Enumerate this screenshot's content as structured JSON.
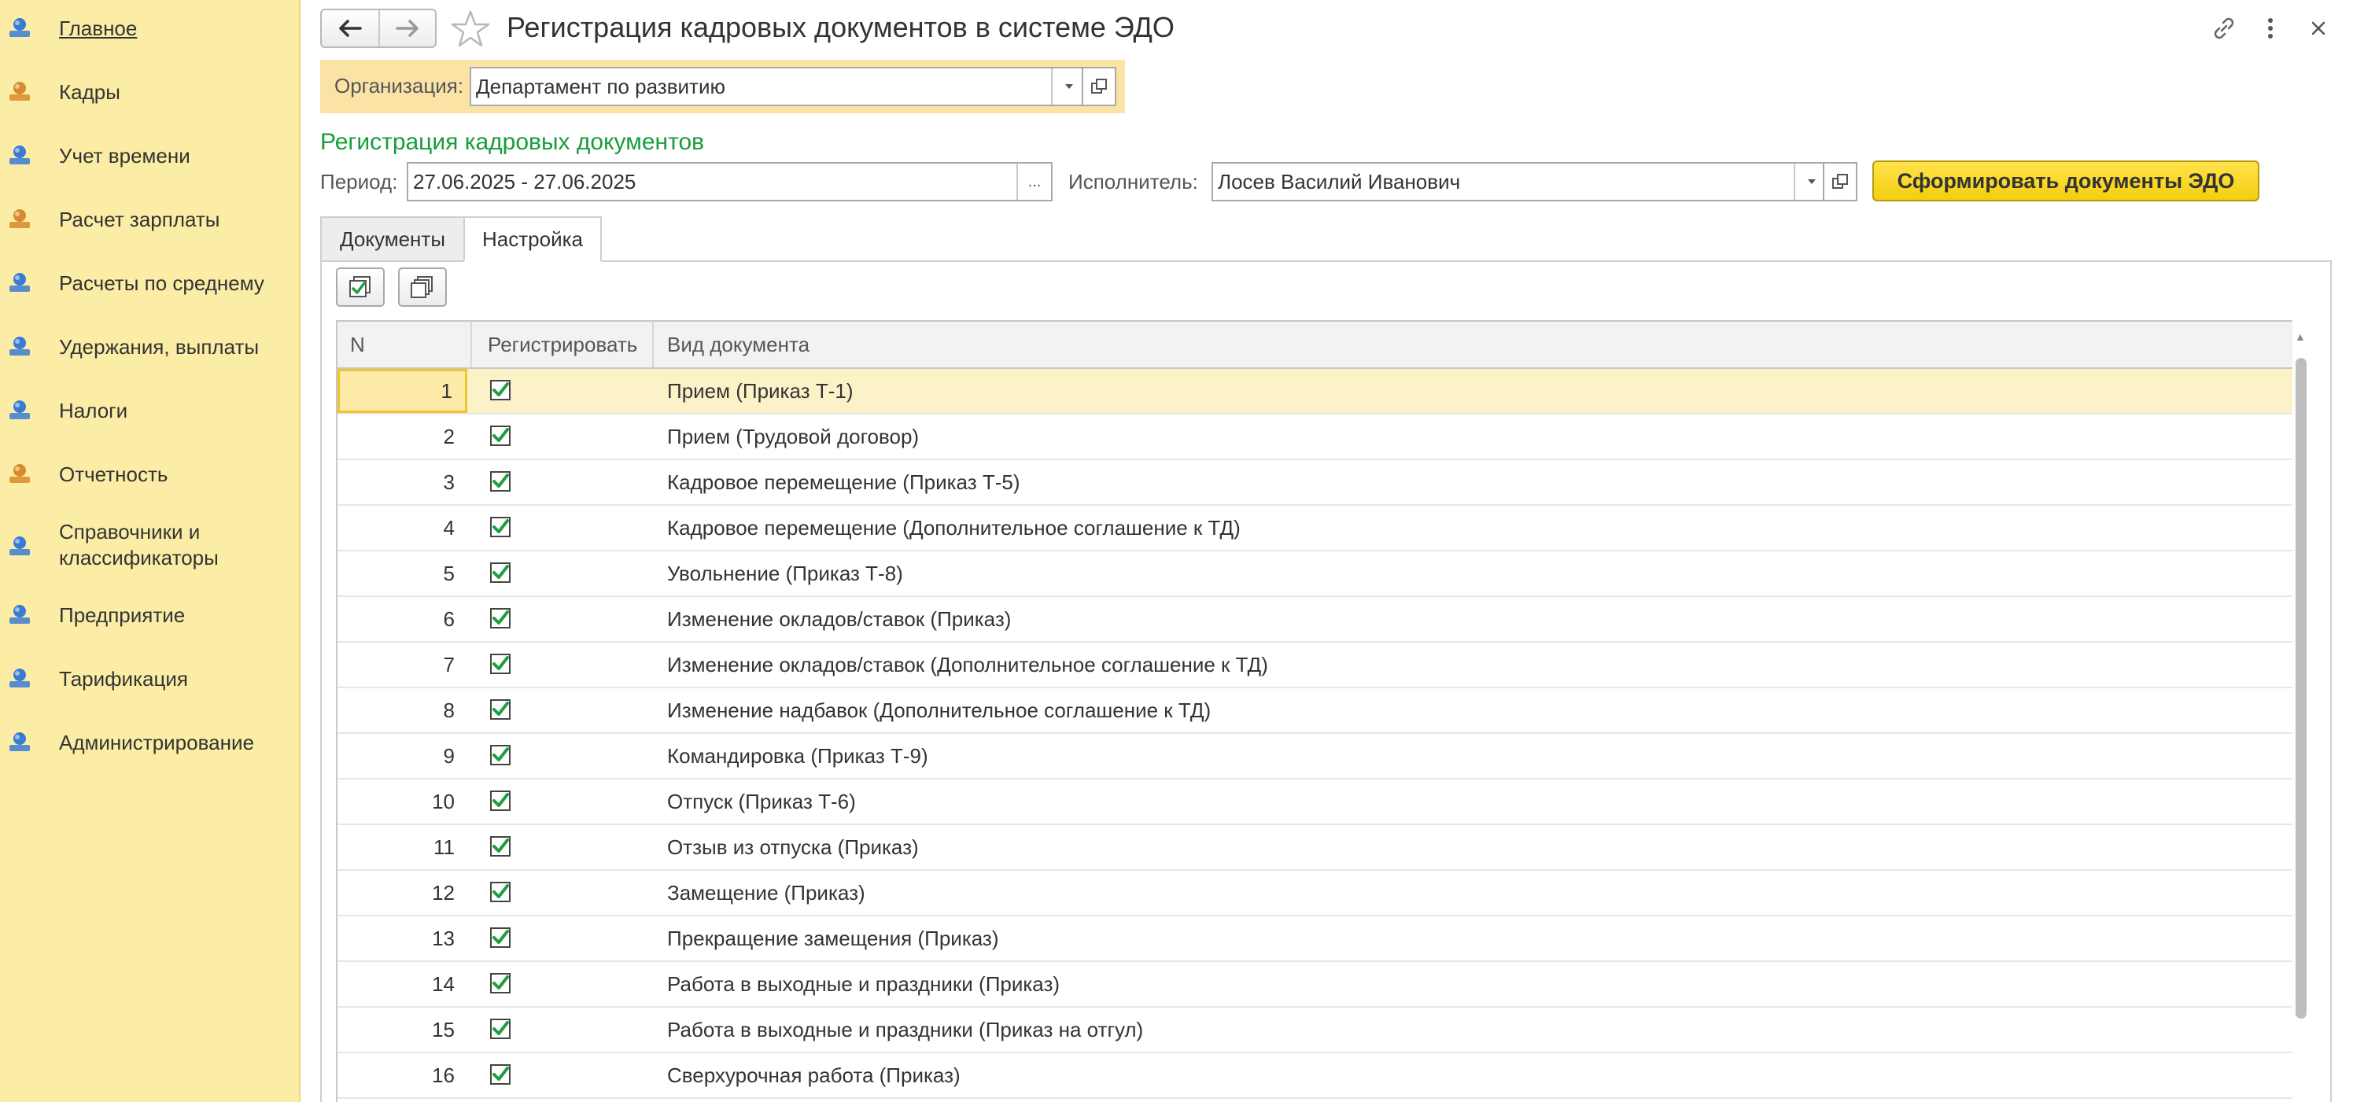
{
  "sidebar": {
    "items": [
      {
        "label": "Главное",
        "icon": "home-icon",
        "color": "#3A7BD5",
        "active": true
      },
      {
        "label": "Кадры",
        "icon": "people-icon",
        "color": "#D98A2A"
      },
      {
        "label": "Учет времени",
        "icon": "clock-globe-icon",
        "color": "#3A7BD5"
      },
      {
        "label": "Расчет зарплаты",
        "icon": "calculator-icon",
        "color": "#D98A2A"
      },
      {
        "label": "Расчеты по среднему",
        "icon": "chart-icon",
        "color": "#3A7BD5"
      },
      {
        "label": "Удержания, выплаты",
        "icon": "money-icon",
        "color": "#3A7BD5"
      },
      {
        "label": "Налоги",
        "icon": "globe-icon",
        "color": "#3A7BD5"
      },
      {
        "label": "Отчетность",
        "icon": "report-icon",
        "color": "#D98A2A"
      },
      {
        "label": "Справочники и классификаторы",
        "icon": "directory-icon",
        "color": "#3A7BD5"
      },
      {
        "label": "Предприятие",
        "icon": "factory-icon",
        "color": "#3A7BD5"
      },
      {
        "label": "Тарификация",
        "icon": "tariff-chart-icon",
        "color": "#3A7BD5"
      },
      {
        "label": "Администрирование",
        "icon": "gears-icon",
        "color": "#3A7BD5"
      }
    ]
  },
  "header": {
    "title": "Регистрация кадровых документов в системе ЭДО"
  },
  "organization": {
    "label": "Организация:",
    "value": "Департамент по развитию"
  },
  "section_title": "Регистрация кадровых документов",
  "filters": {
    "period_label": "Период:",
    "period_value": "27.06.2025 - 27.06.2025",
    "period_btn": "...",
    "executor_label": "Исполнитель:",
    "executor_value": "Лосев Василий Иванович"
  },
  "generate_button": "Сформировать документы ЭДО",
  "tabs": [
    {
      "label": "Документы",
      "active": false
    },
    {
      "label": "Настройка",
      "active": true
    }
  ],
  "table": {
    "columns": [
      "N",
      "Регистрировать",
      "Вид документа"
    ],
    "rows": [
      {
        "n": "1",
        "checked": true,
        "doc": "Прием (Приказ Т-1)"
      },
      {
        "n": "2",
        "checked": true,
        "doc": "Прием (Трудовой договор)"
      },
      {
        "n": "3",
        "checked": true,
        "doc": "Кадровое перемещение (Приказ Т-5)"
      },
      {
        "n": "4",
        "checked": true,
        "doc": "Кадровое перемещение (Дополнительное соглашение к ТД)"
      },
      {
        "n": "5",
        "checked": true,
        "doc": "Увольнение (Приказ Т-8)"
      },
      {
        "n": "6",
        "checked": true,
        "doc": "Изменение окладов/ставок (Приказ)"
      },
      {
        "n": "7",
        "checked": true,
        "doc": "Изменение окладов/ставок (Дополнительное соглашение к ТД)"
      },
      {
        "n": "8",
        "checked": true,
        "doc": "Изменение надбавок (Дополнительное соглашение к ТД)"
      },
      {
        "n": "9",
        "checked": true,
        "doc": "Командировка (Приказ Т-9)"
      },
      {
        "n": "10",
        "checked": true,
        "doc": "Отпуск (Приказ Т-6)"
      },
      {
        "n": "11",
        "checked": true,
        "doc": "Отзыв из отпуска (Приказ)"
      },
      {
        "n": "12",
        "checked": true,
        "doc": "Замещение (Приказ)"
      },
      {
        "n": "13",
        "checked": true,
        "doc": "Прекращение замещения (Приказ)"
      },
      {
        "n": "14",
        "checked": true,
        "doc": "Работа в выходные и праздники (Приказ)"
      },
      {
        "n": "15",
        "checked": true,
        "doc": "Работа в выходные и праздники (Приказ на отгул)"
      },
      {
        "n": "16",
        "checked": true,
        "doc": "Сверхурочная работа (Приказ)"
      }
    ],
    "selected_row": 0
  },
  "colors": {
    "sidebar_bg": "#FBEDA5",
    "accent_green": "#179D3C",
    "check_green": "#1E9E3E",
    "primary_button": "#F5CE10",
    "selected_row": "#FCF2C8"
  }
}
